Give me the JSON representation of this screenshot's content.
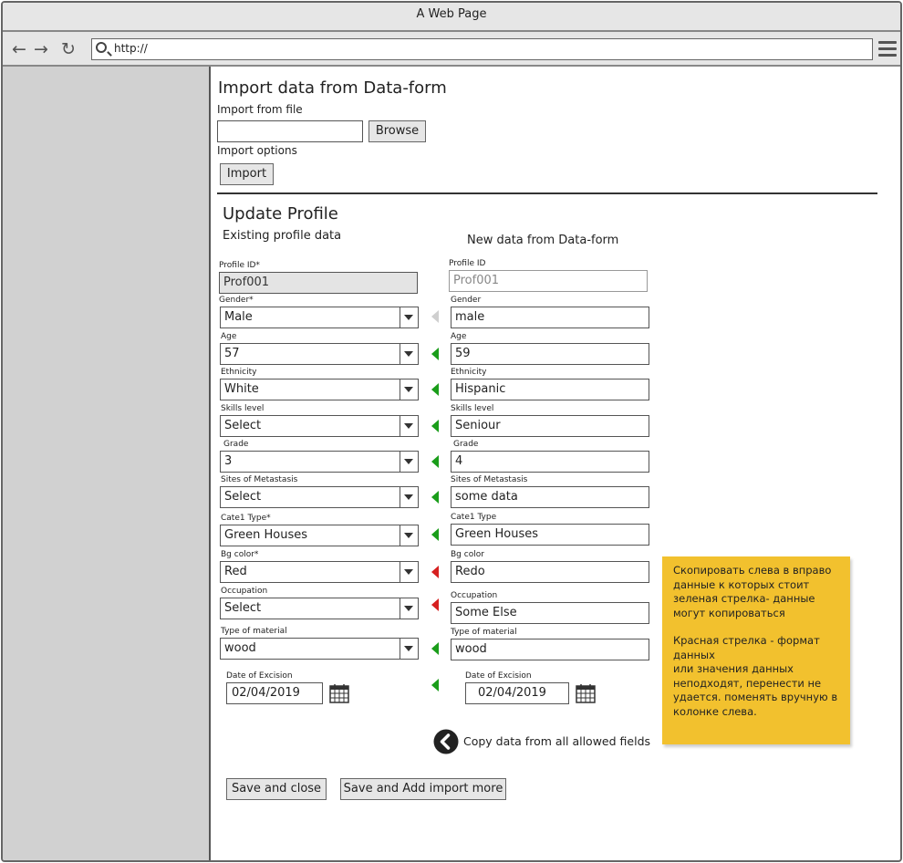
{
  "window": {
    "title": "A Web Page"
  },
  "browser": {
    "url": "http://"
  },
  "import": {
    "title": "Import data from Data-form",
    "file_label": "Import from file",
    "file_value": "",
    "browse_label": "Browse",
    "options_label": "Import options",
    "import_label": "Import"
  },
  "update": {
    "title": "Update Profile",
    "existing_label": "Existing profile data",
    "new_label": "New data from Data-form"
  },
  "rows": [
    {
      "left_label": "Profile ID*",
      "left_value": "Prof001",
      "right_label": "Profile ID",
      "right_value": "Prof001",
      "arrow": "none"
    },
    {
      "left_label": "Gender*",
      "left_value": "Male",
      "right_label": "Gender",
      "right_value": "male",
      "arrow": "grey"
    },
    {
      "left_label": "Age",
      "left_value": "57",
      "right_label": "Age",
      "right_value": "59",
      "arrow": "green"
    },
    {
      "left_label": "Ethnicity",
      "left_value": "White",
      "right_label": "Ethnicity",
      "right_value": "Hispanic",
      "arrow": "green"
    },
    {
      "left_label": "Skills level",
      "left_value": "Select",
      "right_label": "Skills level",
      "right_value": "Seniour",
      "arrow": "green"
    },
    {
      "left_label": "Grade",
      "left_value": "3",
      "right_label": "Grade",
      "right_value": "4",
      "arrow": "green"
    },
    {
      "left_label": "Sites of Metastasis",
      "left_value": "Select",
      "right_label": "Sites of Metastasis",
      "right_value": "some data",
      "arrow": "green"
    },
    {
      "left_label": "Cate1 Type*",
      "left_value": "Green Houses",
      "right_label": "Cate1 Type",
      "right_value": "Green Houses",
      "arrow": "green"
    },
    {
      "left_label": "Bg color*",
      "left_value": "Red",
      "right_label": "Bg color",
      "right_value": "Redo",
      "arrow": "red"
    },
    {
      "left_label": "Occupation",
      "left_value": "Select",
      "right_label": "Occupation",
      "right_value": "Some Else",
      "arrow": "red"
    },
    {
      "left_label": "Type of material",
      "left_value": "wood",
      "right_label": "Type of material",
      "right_value": "wood",
      "arrow": "green"
    }
  ],
  "excision": {
    "left_label": "Date of Excision",
    "left_value": "02/04/2019",
    "right_label": "Date of Excision",
    "right_value": "02/04/2019",
    "arrow": "green"
  },
  "copy_all": {
    "label": "Copy data from all allowed fields"
  },
  "actions": {
    "save_close": "Save and close",
    "save_add": "Save and Add import more"
  },
  "note": {
    "paragraph1": "Скопировать слева в вправо данные к которых стоит зеленая стрелка- данные могут копироваться",
    "paragraph2": "Красная стрелка - формат данных\nили значения данных неподходят, перенести не удается. поменять вручную в колонке слева."
  },
  "colors": {
    "green_arrow": "#1a9d1a",
    "red_arrow": "#d62020",
    "grey_arrow": "#cfcfcf",
    "note_bg": "#f2c12e"
  }
}
